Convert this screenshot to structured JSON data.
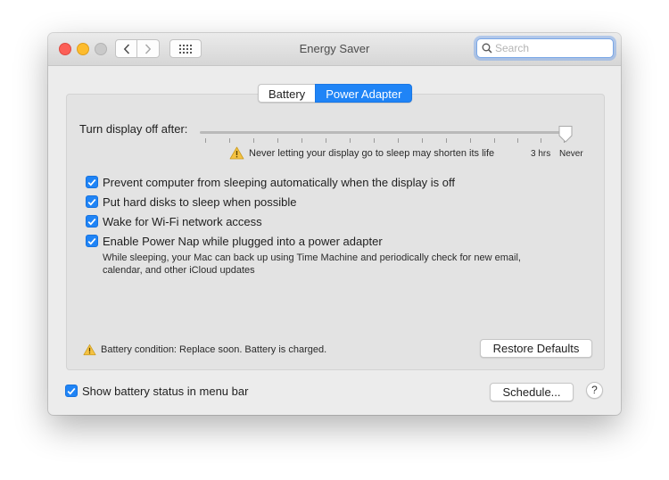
{
  "window": {
    "title": "Energy Saver"
  },
  "search": {
    "placeholder": "Search",
    "value": ""
  },
  "tabs": [
    {
      "label": "Battery",
      "selected": false
    },
    {
      "label": "Power Adapter",
      "selected": true
    }
  ],
  "display_sleep": {
    "label": "Turn display off after:",
    "warning": "Never letting your display go to sleep may shorten its life",
    "tick_labels": [
      "3 hrs",
      "Never"
    ],
    "current_value": "Never"
  },
  "options": [
    {
      "label": "Prevent computer from sleeping automatically when the display is off",
      "checked": true
    },
    {
      "label": "Put hard disks to sleep when possible",
      "checked": true
    },
    {
      "label": "Wake for Wi-Fi network access",
      "checked": true
    },
    {
      "label": "Enable Power Nap while plugged into a power adapter",
      "checked": true,
      "description_line1": "While sleeping, your Mac can back up using Time Machine and periodically check for new email,",
      "description_line2": "calendar, and other iCloud updates"
    }
  ],
  "battery_condition": "Battery condition: Replace soon. Battery is charged.",
  "buttons": {
    "restore_defaults": "Restore Defaults",
    "schedule": "Schedule...",
    "help": "?"
  },
  "footer": {
    "show_battery_status": {
      "label": "Show battery status in menu bar",
      "checked": true
    }
  },
  "colors": {
    "accent": "#1f84f6",
    "close": "#fc5f57",
    "minimize": "#fdbc2e",
    "zoom_disabled": "#c9c9c9",
    "warning": "#f5c242"
  }
}
